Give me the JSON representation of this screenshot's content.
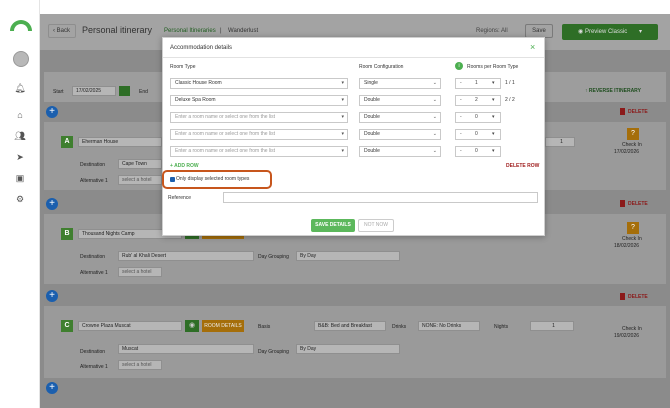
{
  "header": {
    "back_label": "Back",
    "title": "Personal itinerary",
    "breadcrumb_root": "Personal Itineraries",
    "breadcrumb_sep": "|",
    "breadcrumb_current": "Wanderlust",
    "regions_label": "Regions: All",
    "save_label": "Save",
    "preview_label": "Preview Classic"
  },
  "controls": {
    "start_label": "Start",
    "start_date": "17/02/2025",
    "end_label": "End",
    "reverse_label": "REVERSE ITINERARY",
    "delete_label": "DELETE"
  },
  "stops": [
    {
      "letter": "A",
      "name": "Eherman House",
      "destination_label": "Destination",
      "destination": "Cape Town",
      "alternative_label": "Alternative 1",
      "alternative_placeholder": "select a hotel",
      "nights": "1",
      "checkin_label": "Check In",
      "checkin_date": "17/02/2026",
      "delete_label": "DELETE"
    },
    {
      "letter": "B",
      "name": "Thousand Nights Camp",
      "destination_label": "Destination",
      "destination": "Rub' al Khali Desert",
      "grouping_label": "Day Grouping",
      "grouping": "By Day",
      "alternative_label": "Alternative 1",
      "alternative_placeholder": "select a hotel",
      "checkin_label": "Check In",
      "checkin_date": "18/02/2026",
      "delete_label": "DELETE"
    },
    {
      "letter": "C",
      "name": "Crowne Plaza Muscat",
      "room_details_label": "ROOM DETAILS",
      "basis_label": "Basis",
      "basis": "B&B: Bed and Breakfast",
      "drinks_label": "Drinks",
      "drinks": "NONE: No Drinks",
      "nights_label": "Nights",
      "nights": "1",
      "destination_label": "Destination",
      "destination": "Muscat",
      "grouping_label": "Day Grouping",
      "grouping": "By Day",
      "alternative_label": "Alternative 1",
      "alternative_placeholder": "select a hotel",
      "checkin_label": "Check In",
      "checkin_date": "19/02/2026"
    }
  ],
  "modal": {
    "title": "Accommodation details",
    "col_room_type": "Room Type",
    "col_room_config": "Room Configuration",
    "col_rooms_per_type": "Rooms per Room Type",
    "rooms": [
      {
        "type": "Classic House Room",
        "config": "Single",
        "count": "1",
        "ratio": "1 / 1"
      },
      {
        "type": "Deluxe Spa Room",
        "config": "Double",
        "count": "2",
        "ratio": "2 / 2"
      },
      {
        "type": "",
        "config": "Double",
        "count": "0",
        "ratio": ""
      },
      {
        "type": "",
        "config": "Double",
        "count": "0",
        "ratio": ""
      },
      {
        "type": "",
        "config": "Double",
        "count": "0",
        "ratio": ""
      }
    ],
    "room_placeholder": "Enter a room name or select one from the list",
    "add_row": "+ ADD ROW",
    "delete_row": "DELETE ROW",
    "checkbox_label": "Only display selected room types",
    "checkbox_checked": true,
    "reference_label": "Reference",
    "reference_value": "",
    "save_label": "SAVE DETAILS",
    "cancel_label": "NOT NOW",
    "close_label": "×"
  },
  "colors": {
    "brand_green": "#4caf50",
    "accent_blue": "#1b5fae",
    "highlight_orange": "#c7561d",
    "delete_red": "#8b1a1a"
  }
}
